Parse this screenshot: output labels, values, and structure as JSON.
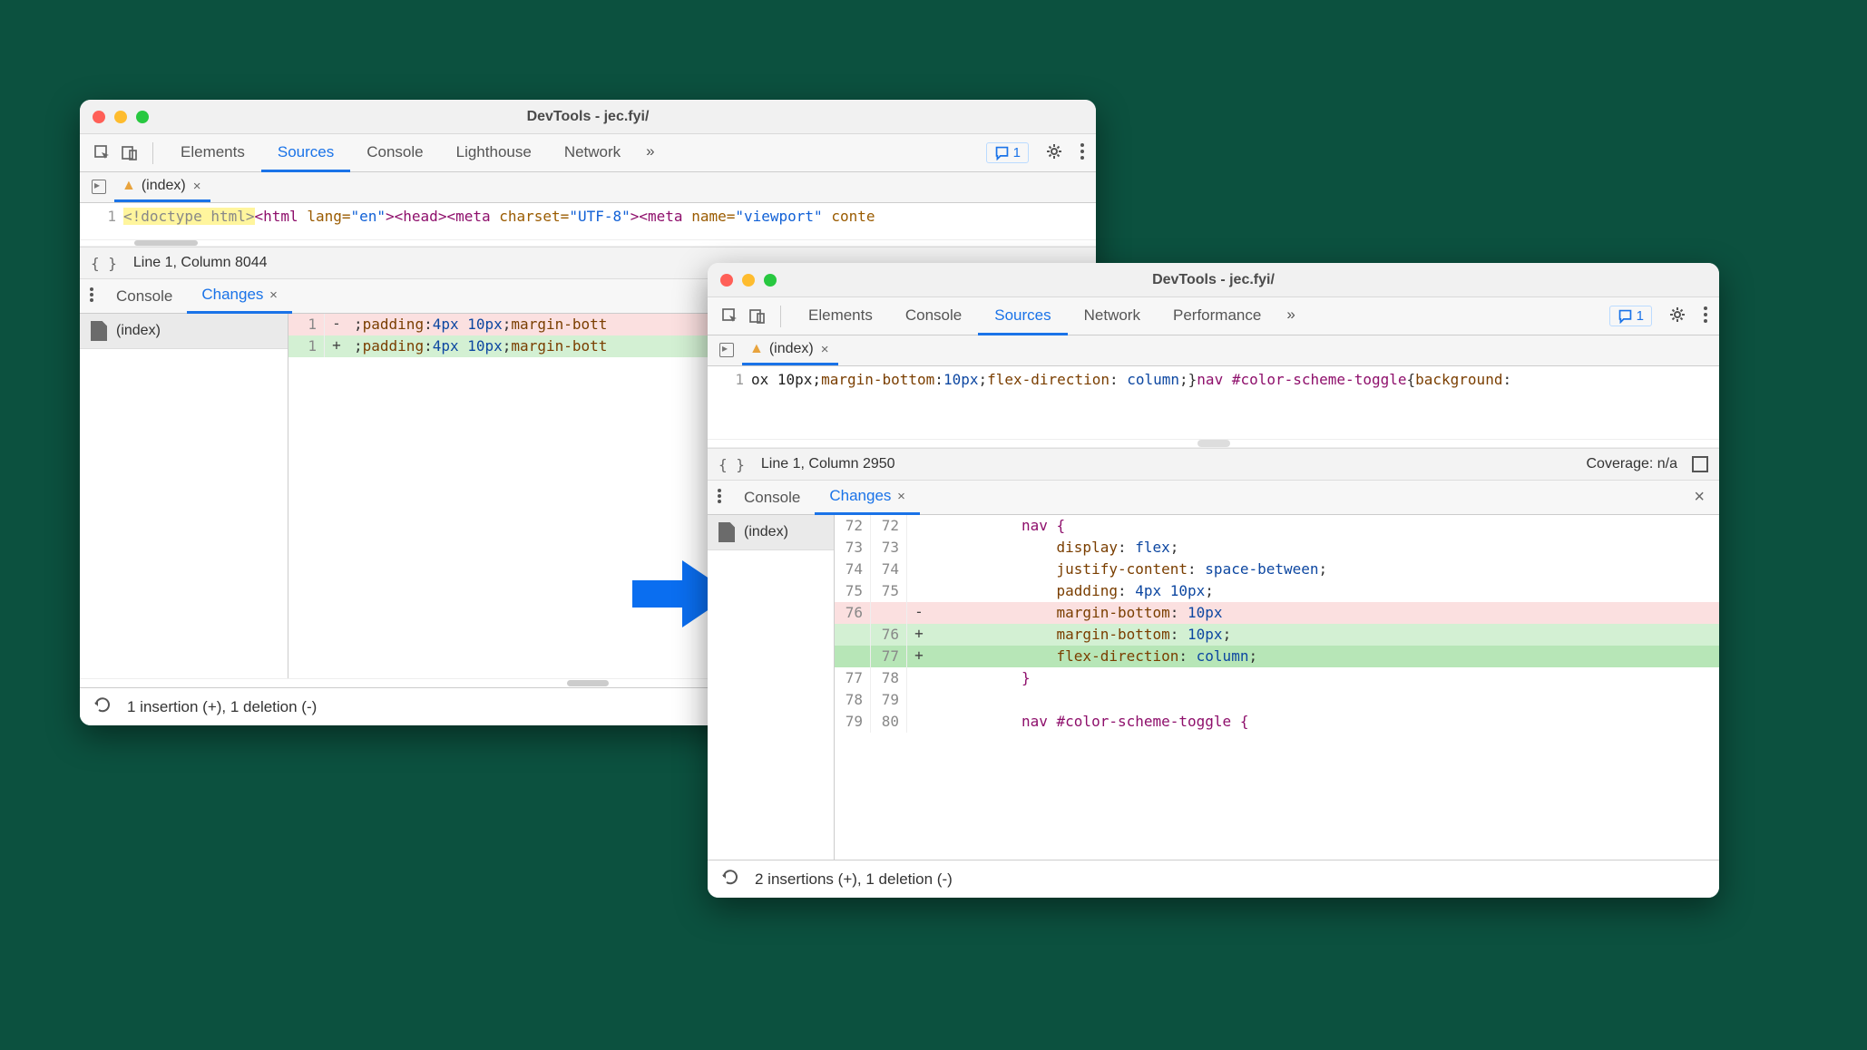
{
  "title": "DevTools - jec.fyi/",
  "tabs_a": [
    "Elements",
    "Sources",
    "Console",
    "Lighthouse",
    "Network"
  ],
  "tabs_b": [
    "Elements",
    "Console",
    "Sources",
    "Network",
    "Performance"
  ],
  "more_glyph": "»",
  "issues_count": "1",
  "file_tab_label": "(index)",
  "code_a_line1": "<!doctype html><html lang=\"en\"><head><meta charset=\"UTF-8\"><meta name=\"viewport\" conte",
  "status_a": "Line 1, Column 8044",
  "drawer_tabs": [
    "Console",
    "Changes"
  ],
  "sidebar_file": "(index)",
  "diff_a": {
    "line_old": "1",
    "line_new": "1",
    "minus_text": ";padding:4px 10px;margin-bott",
    "plus_text": ";padding:4px 10px;margin-bott"
  },
  "scroll_pill": "",
  "footer_a": "1 insertion (+), 1 deletion (-)",
  "code_b_line1": "ox 10px;margin-bottom:10px;flex-direction: column;}nav #color-scheme-toggle{background:",
  "status_b_left": "Line 1, Column 2950",
  "status_b_right": "Coverage: n/a",
  "diff_b": [
    {
      "o": "72",
      "n": "72",
      "s": "",
      "t": "nav {",
      "cls": ""
    },
    {
      "o": "73",
      "n": "73",
      "s": "",
      "t": "    display: flex;",
      "cls": ""
    },
    {
      "o": "74",
      "n": "74",
      "s": "",
      "t": "    justify-content: space-between;",
      "cls": ""
    },
    {
      "o": "75",
      "n": "75",
      "s": "",
      "t": "    padding: 4px 10px;",
      "cls": ""
    },
    {
      "o": "76",
      "n": "",
      "s": "-",
      "t": "    margin-bottom: 10px",
      "cls": "row-del"
    },
    {
      "o": "",
      "n": "76",
      "s": "+",
      "t": "    margin-bottom: 10px;",
      "cls": "row-add"
    },
    {
      "o": "",
      "n": "77",
      "s": "+",
      "t": "    flex-direction: column;",
      "cls": "row-add strong"
    },
    {
      "o": "77",
      "n": "78",
      "s": "",
      "t": "}",
      "cls": ""
    },
    {
      "o": "78",
      "n": "79",
      "s": "",
      "t": "",
      "cls": ""
    },
    {
      "o": "79",
      "n": "80",
      "s": "",
      "t": "nav #color-scheme-toggle {",
      "cls": ""
    }
  ],
  "footer_b": "2 insertions (+), 1 deletion (-)"
}
